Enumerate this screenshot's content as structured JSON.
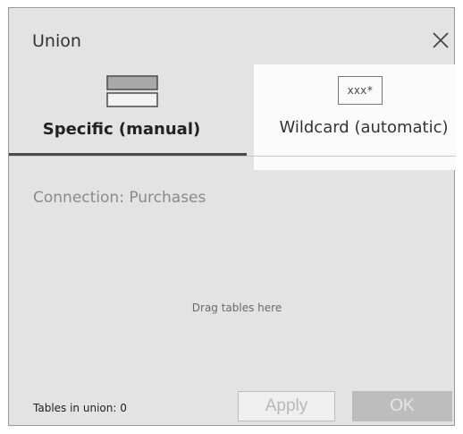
{
  "dialog": {
    "title": "Union",
    "close_icon": "close-icon"
  },
  "tabs": [
    {
      "label": "Specific (manual)",
      "icon": "stacked-rows-icon",
      "selected": true
    },
    {
      "label": "Wildcard (automatic)",
      "icon": "wildcard-pattern-icon",
      "icon_text": "xxx*",
      "selected": false
    }
  ],
  "main": {
    "connection": "Connection: Purchases",
    "drop_hint": "Drag tables here"
  },
  "footer": {
    "tables_count": "Tables in union: 0",
    "apply_label": "Apply",
    "ok_label": "OK"
  }
}
